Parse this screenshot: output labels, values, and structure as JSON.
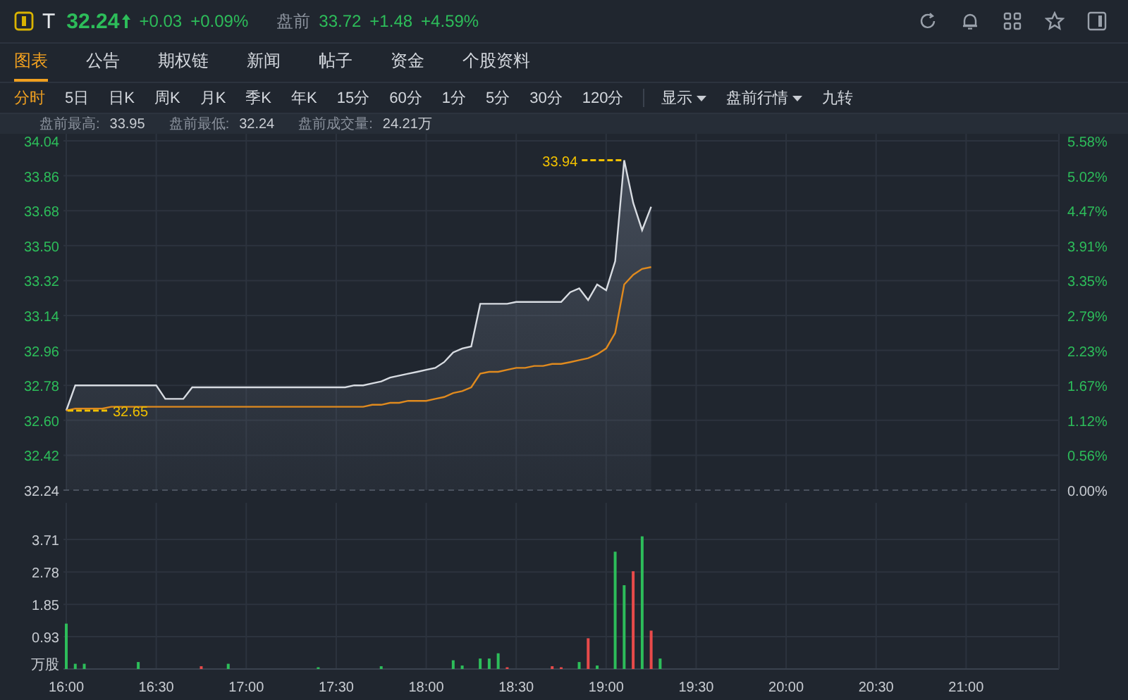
{
  "quote": {
    "symbol": "T",
    "price": "32.24",
    "change": "+0.03",
    "change_pct": "+0.09%",
    "session_label": "盘前",
    "session_price": "33.72",
    "session_change": "+1.48",
    "session_change_pct": "+4.59%"
  },
  "tabs": [
    {
      "label": "图表",
      "selected": true
    },
    {
      "label": "公告",
      "selected": false
    },
    {
      "label": "期权链",
      "selected": false
    },
    {
      "label": "新闻",
      "selected": false
    },
    {
      "label": "帖子",
      "selected": false
    },
    {
      "label": "资金",
      "selected": false
    },
    {
      "label": "个股资料",
      "selected": false
    }
  ],
  "periods": [
    {
      "label": "分时",
      "selected": true
    },
    {
      "label": "5日",
      "selected": false
    },
    {
      "label": "日K",
      "selected": false
    },
    {
      "label": "周K",
      "selected": false
    },
    {
      "label": "月K",
      "selected": false
    },
    {
      "label": "季K",
      "selected": false
    },
    {
      "label": "年K",
      "selected": false
    },
    {
      "label": "15分",
      "selected": false
    },
    {
      "label": "60分",
      "selected": false
    },
    {
      "label": "1分",
      "selected": false
    },
    {
      "label": "5分",
      "selected": false
    },
    {
      "label": "30分",
      "selected": false
    },
    {
      "label": "120分",
      "selected": false
    }
  ],
  "options": [
    {
      "label": "显示",
      "kind": "dropdown"
    },
    {
      "label": "盘前行情",
      "kind": "dropdown"
    },
    {
      "label": "九转",
      "kind": "toggle"
    }
  ],
  "stats": [
    {
      "label": "盘前最高:",
      "value": "33.95"
    },
    {
      "label": "盘前最低:",
      "value": "32.24"
    },
    {
      "label": "盘前成交量:",
      "value": "24.21万"
    }
  ],
  "price_chart": {
    "percent_labels": [
      "5.58%",
      "5.02%",
      "4.47%",
      "3.91%",
      "3.35%",
      "2.79%",
      "2.23%",
      "1.67%",
      "1.12%",
      "0.56%",
      "0.00%"
    ],
    "chart_data": {
      "type": "area",
      "grid": true,
      "series": [
        {
          "color": "#d8dce2",
          "values": [
            32.65,
            32.78,
            32.78,
            32.78,
            32.78,
            32.78,
            32.78,
            32.78,
            32.78,
            32.78,
            32.78,
            32.71,
            32.71,
            32.71,
            32.77,
            32.77,
            32.77,
            32.77,
            32.77,
            32.77,
            32.77,
            32.77,
            32.77,
            32.77,
            32.77,
            32.77,
            32.77,
            32.77,
            32.77,
            32.77,
            32.77,
            32.77,
            32.78,
            32.78,
            32.79,
            32.8,
            32.82,
            32.83,
            32.84,
            32.85,
            32.86,
            32.87,
            32.9,
            32.95,
            32.97,
            32.98,
            33.2,
            33.2,
            33.2,
            33.2,
            33.21,
            33.21,
            33.21,
            33.21,
            33.21,
            33.21,
            33.26,
            33.28,
            33.22,
            33.3,
            33.27,
            33.42,
            33.94,
            33.72,
            33.58,
            33.7,
            null,
            null,
            null,
            null,
            null,
            null,
            null,
            null,
            null,
            null,
            null,
            null,
            null,
            null,
            null,
            null,
            null,
            null,
            null,
            null,
            null,
            null,
            null,
            null,
            null,
            null,
            null,
            null,
            null,
            null,
            null,
            null,
            null,
            null,
            null,
            null,
            null,
            null,
            null,
            null,
            null,
            null,
            null,
            null
          ]
        },
        {
          "color": "#e08a1e",
          "type": "line",
          "values": [
            32.65,
            32.66,
            32.66,
            32.66,
            32.66,
            32.67,
            32.67,
            32.67,
            32.67,
            32.67,
            32.67,
            32.67,
            32.67,
            32.67,
            32.67,
            32.67,
            32.67,
            32.67,
            32.67,
            32.67,
            32.67,
            32.67,
            32.67,
            32.67,
            32.67,
            32.67,
            32.67,
            32.67,
            32.67,
            32.67,
            32.67,
            32.67,
            32.67,
            32.67,
            32.68,
            32.68,
            32.69,
            32.69,
            32.7,
            32.7,
            32.7,
            32.71,
            32.72,
            32.74,
            32.75,
            32.77,
            32.84,
            32.85,
            32.85,
            32.86,
            32.87,
            32.87,
            32.88,
            32.88,
            32.89,
            32.89,
            32.9,
            32.91,
            32.92,
            32.94,
            32.97,
            33.05,
            33.3,
            33.35,
            33.38,
            33.39,
            null,
            null,
            null,
            null,
            null,
            null,
            null,
            null,
            null,
            null,
            null,
            null,
            null,
            null,
            null,
            null,
            null,
            null,
            null,
            null,
            null,
            null,
            null,
            null,
            null,
            null,
            null,
            null,
            null,
            null,
            null,
            null,
            null,
            null,
            null,
            null,
            null,
            null,
            null,
            null,
            null,
            null,
            null,
            null
          ]
        }
      ],
      "ylim": [
        32.24,
        34.04
      ],
      "yticks": [
        {
          "value": 32.24,
          "label": "32.24"
        },
        {
          "value": 32.42,
          "label": "32.42"
        },
        {
          "value": 32.6,
          "label": "32.60"
        },
        {
          "value": 32.78,
          "label": "32.78"
        },
        {
          "value": 32.96,
          "label": "32.96"
        },
        {
          "value": 33.14,
          "label": "33.14"
        },
        {
          "value": 33.32,
          "label": "33.32"
        },
        {
          "value": 33.5,
          "label": "33.50"
        },
        {
          "value": 33.68,
          "label": "33.68"
        },
        {
          "value": 33.86,
          "label": "33.86"
        },
        {
          "value": 34.04,
          "label": "34.04"
        }
      ],
      "annotations": [
        "33.94",
        "32.65"
      ]
    }
  },
  "volume_chart": {
    "chart_data": {
      "type": "bar",
      "grid": true,
      "ylabel": "万股",
      "categories": [
        "16:00",
        null,
        null,
        null,
        null,
        null,
        null,
        null,
        null,
        null,
        "16:30",
        null,
        null,
        null,
        null,
        null,
        null,
        null,
        null,
        null,
        "17:00",
        null,
        null,
        null,
        null,
        null,
        null,
        null,
        null,
        null,
        "17:30",
        null,
        null,
        null,
        null,
        null,
        null,
        null,
        null,
        null,
        "18:00",
        null,
        null,
        null,
        null,
        null,
        null,
        null,
        null,
        null,
        "18:30",
        null,
        null,
        null,
        null,
        null,
        null,
        null,
        null,
        null,
        "19:00",
        null,
        null,
        null,
        null,
        null,
        null,
        null,
        null,
        null,
        "19:30",
        null,
        null,
        null,
        null,
        null,
        null,
        null,
        null,
        null,
        "20:00",
        null,
        null,
        null,
        null,
        null,
        null,
        null,
        null,
        null,
        "20:30",
        null,
        null,
        null,
        null,
        null,
        null,
        null,
        null,
        null,
        "21:00",
        null,
        null,
        null,
        null,
        null,
        null,
        null,
        null,
        null
      ],
      "series": [
        {
          "color": "#2dbd5a",
          "values": [
            1.3,
            0.15,
            0.15,
            null,
            null,
            null,
            null,
            null,
            0.2,
            null,
            null,
            null,
            null,
            null,
            null,
            null,
            null,
            null,
            0.15,
            null,
            null,
            null,
            null,
            null,
            null,
            null,
            null,
            null,
            0.05,
            null,
            null,
            null,
            null,
            null,
            null,
            0.08,
            null,
            null,
            null,
            null,
            null,
            null,
            null,
            0.25,
            0.1,
            null,
            0.3,
            0.3,
            0.45,
            null,
            null,
            null,
            null,
            null,
            null,
            null,
            null,
            0.2,
            null,
            0.1,
            null,
            3.36,
            2.4,
            null,
            3.8,
            null,
            0.3,
            null,
            null,
            null,
            null,
            null,
            null,
            null,
            null,
            null,
            null,
            null,
            null,
            null,
            null,
            null,
            null,
            null,
            null,
            null,
            null,
            null,
            null,
            null,
            null,
            null,
            null,
            null,
            null,
            null,
            null,
            null,
            null,
            null,
            null,
            null,
            null,
            null,
            null,
            null,
            null,
            null,
            null,
            null
          ]
        },
        {
          "color": "#e84a4a",
          "values": [
            null,
            null,
            null,
            null,
            null,
            null,
            null,
            null,
            null,
            null,
            null,
            null,
            null,
            null,
            null,
            0.08,
            null,
            null,
            null,
            null,
            null,
            null,
            null,
            null,
            null,
            null,
            null,
            null,
            null,
            null,
            null,
            null,
            null,
            null,
            null,
            null,
            null,
            null,
            null,
            null,
            null,
            null,
            null,
            null,
            null,
            null,
            null,
            null,
            null,
            0.05,
            null,
            null,
            null,
            null,
            0.08,
            0.05,
            null,
            null,
            0.88,
            null,
            null,
            null,
            null,
            2.8,
            null,
            1.1,
            null,
            null,
            null,
            null,
            null,
            null,
            null,
            null,
            null,
            null,
            null,
            null,
            null,
            null,
            null,
            null,
            null,
            null,
            null,
            null,
            null,
            null,
            null,
            null,
            null,
            null,
            null,
            null,
            null,
            null,
            null,
            null,
            null,
            null,
            null,
            null,
            null,
            null,
            null,
            null,
            null,
            null,
            null,
            null
          ]
        }
      ],
      "ylim": [
        0,
        4.76
      ],
      "yticks": [
        {
          "value": 0.93,
          "label": "0.93"
        },
        {
          "value": 1.85,
          "label": "1.85"
        },
        {
          "value": 2.78,
          "label": "2.78"
        },
        {
          "value": 3.71,
          "label": "3.71"
        }
      ]
    }
  }
}
